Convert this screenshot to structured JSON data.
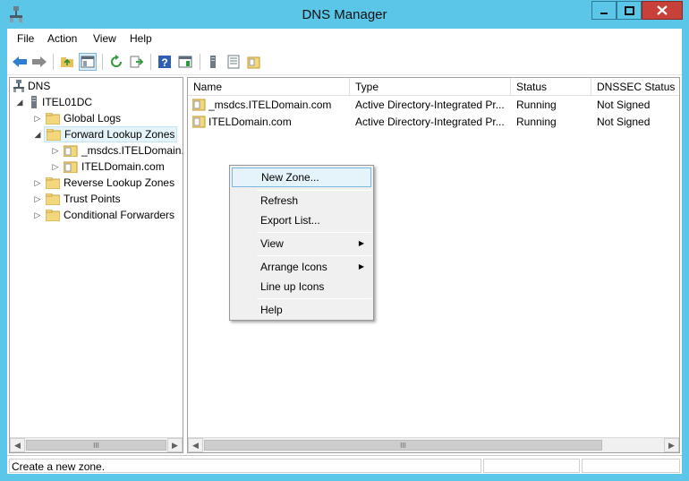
{
  "window": {
    "title": "DNS Manager"
  },
  "menu": [
    "File",
    "Action",
    "View",
    "Help"
  ],
  "tree": {
    "root": "DNS",
    "server": "ITEL01DC",
    "items": [
      {
        "label": "Global Logs"
      },
      {
        "label": "Forward Lookup Zones"
      },
      {
        "label": "_msdcs.ITELDomain.c"
      },
      {
        "label": "ITELDomain.com"
      },
      {
        "label": "Reverse Lookup Zones"
      },
      {
        "label": "Trust Points"
      },
      {
        "label": "Conditional Forwarders"
      }
    ]
  },
  "list": {
    "columns": [
      "Name",
      "Type",
      "Status",
      "DNSSEC Status"
    ],
    "rows": [
      {
        "name": "_msdcs.ITELDomain.com",
        "type": "Active Directory-Integrated Pr...",
        "status": "Running",
        "dnssec": "Not Signed"
      },
      {
        "name": "ITELDomain.com",
        "type": "Active Directory-Integrated Pr...",
        "status": "Running",
        "dnssec": "Not Signed"
      }
    ]
  },
  "context_menu": {
    "new_zone": "New Zone...",
    "refresh": "Refresh",
    "export_list": "Export List...",
    "view": "View",
    "arrange_icons": "Arrange Icons",
    "line_up_icons": "Line up Icons",
    "help": "Help"
  },
  "scroll_thumb_glyph": "III",
  "status_text": "Create a new zone.",
  "colors": {
    "titlebar": "#5cc6e8",
    "close_button": "#c7413a",
    "selection": "#e5f3fb"
  }
}
